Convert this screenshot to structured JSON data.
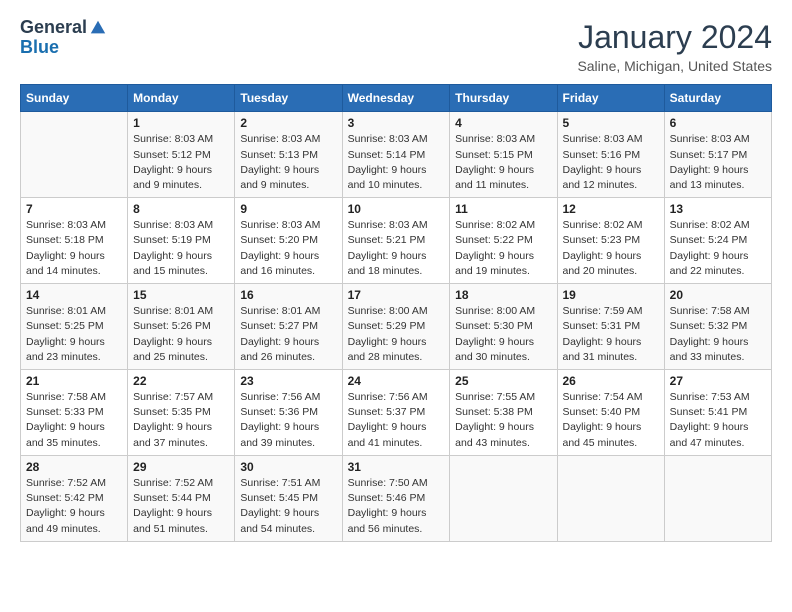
{
  "logo": {
    "general": "General",
    "blue": "Blue"
  },
  "title": "January 2024",
  "subtitle": "Saline, Michigan, United States",
  "days_header": [
    "Sunday",
    "Monday",
    "Tuesday",
    "Wednesday",
    "Thursday",
    "Friday",
    "Saturday"
  ],
  "weeks": [
    [
      {
        "day": "",
        "info": ""
      },
      {
        "day": "1",
        "info": "Sunrise: 8:03 AM\nSunset: 5:12 PM\nDaylight: 9 hours\nand 9 minutes."
      },
      {
        "day": "2",
        "info": "Sunrise: 8:03 AM\nSunset: 5:13 PM\nDaylight: 9 hours\nand 9 minutes."
      },
      {
        "day": "3",
        "info": "Sunrise: 8:03 AM\nSunset: 5:14 PM\nDaylight: 9 hours\nand 10 minutes."
      },
      {
        "day": "4",
        "info": "Sunrise: 8:03 AM\nSunset: 5:15 PM\nDaylight: 9 hours\nand 11 minutes."
      },
      {
        "day": "5",
        "info": "Sunrise: 8:03 AM\nSunset: 5:16 PM\nDaylight: 9 hours\nand 12 minutes."
      },
      {
        "day": "6",
        "info": "Sunrise: 8:03 AM\nSunset: 5:17 PM\nDaylight: 9 hours\nand 13 minutes."
      }
    ],
    [
      {
        "day": "7",
        "info": "Sunrise: 8:03 AM\nSunset: 5:18 PM\nDaylight: 9 hours\nand 14 minutes."
      },
      {
        "day": "8",
        "info": "Sunrise: 8:03 AM\nSunset: 5:19 PM\nDaylight: 9 hours\nand 15 minutes."
      },
      {
        "day": "9",
        "info": "Sunrise: 8:03 AM\nSunset: 5:20 PM\nDaylight: 9 hours\nand 16 minutes."
      },
      {
        "day": "10",
        "info": "Sunrise: 8:03 AM\nSunset: 5:21 PM\nDaylight: 9 hours\nand 18 minutes."
      },
      {
        "day": "11",
        "info": "Sunrise: 8:02 AM\nSunset: 5:22 PM\nDaylight: 9 hours\nand 19 minutes."
      },
      {
        "day": "12",
        "info": "Sunrise: 8:02 AM\nSunset: 5:23 PM\nDaylight: 9 hours\nand 20 minutes."
      },
      {
        "day": "13",
        "info": "Sunrise: 8:02 AM\nSunset: 5:24 PM\nDaylight: 9 hours\nand 22 minutes."
      }
    ],
    [
      {
        "day": "14",
        "info": "Sunrise: 8:01 AM\nSunset: 5:25 PM\nDaylight: 9 hours\nand 23 minutes."
      },
      {
        "day": "15",
        "info": "Sunrise: 8:01 AM\nSunset: 5:26 PM\nDaylight: 9 hours\nand 25 minutes."
      },
      {
        "day": "16",
        "info": "Sunrise: 8:01 AM\nSunset: 5:27 PM\nDaylight: 9 hours\nand 26 minutes."
      },
      {
        "day": "17",
        "info": "Sunrise: 8:00 AM\nSunset: 5:29 PM\nDaylight: 9 hours\nand 28 minutes."
      },
      {
        "day": "18",
        "info": "Sunrise: 8:00 AM\nSunset: 5:30 PM\nDaylight: 9 hours\nand 30 minutes."
      },
      {
        "day": "19",
        "info": "Sunrise: 7:59 AM\nSunset: 5:31 PM\nDaylight: 9 hours\nand 31 minutes."
      },
      {
        "day": "20",
        "info": "Sunrise: 7:58 AM\nSunset: 5:32 PM\nDaylight: 9 hours\nand 33 minutes."
      }
    ],
    [
      {
        "day": "21",
        "info": "Sunrise: 7:58 AM\nSunset: 5:33 PM\nDaylight: 9 hours\nand 35 minutes."
      },
      {
        "day": "22",
        "info": "Sunrise: 7:57 AM\nSunset: 5:35 PM\nDaylight: 9 hours\nand 37 minutes."
      },
      {
        "day": "23",
        "info": "Sunrise: 7:56 AM\nSunset: 5:36 PM\nDaylight: 9 hours\nand 39 minutes."
      },
      {
        "day": "24",
        "info": "Sunrise: 7:56 AM\nSunset: 5:37 PM\nDaylight: 9 hours\nand 41 minutes."
      },
      {
        "day": "25",
        "info": "Sunrise: 7:55 AM\nSunset: 5:38 PM\nDaylight: 9 hours\nand 43 minutes."
      },
      {
        "day": "26",
        "info": "Sunrise: 7:54 AM\nSunset: 5:40 PM\nDaylight: 9 hours\nand 45 minutes."
      },
      {
        "day": "27",
        "info": "Sunrise: 7:53 AM\nSunset: 5:41 PM\nDaylight: 9 hours\nand 47 minutes."
      }
    ],
    [
      {
        "day": "28",
        "info": "Sunrise: 7:52 AM\nSunset: 5:42 PM\nDaylight: 9 hours\nand 49 minutes."
      },
      {
        "day": "29",
        "info": "Sunrise: 7:52 AM\nSunset: 5:44 PM\nDaylight: 9 hours\nand 51 minutes."
      },
      {
        "day": "30",
        "info": "Sunrise: 7:51 AM\nSunset: 5:45 PM\nDaylight: 9 hours\nand 54 minutes."
      },
      {
        "day": "31",
        "info": "Sunrise: 7:50 AM\nSunset: 5:46 PM\nDaylight: 9 hours\nand 56 minutes."
      },
      {
        "day": "",
        "info": ""
      },
      {
        "day": "",
        "info": ""
      },
      {
        "day": "",
        "info": ""
      }
    ]
  ]
}
